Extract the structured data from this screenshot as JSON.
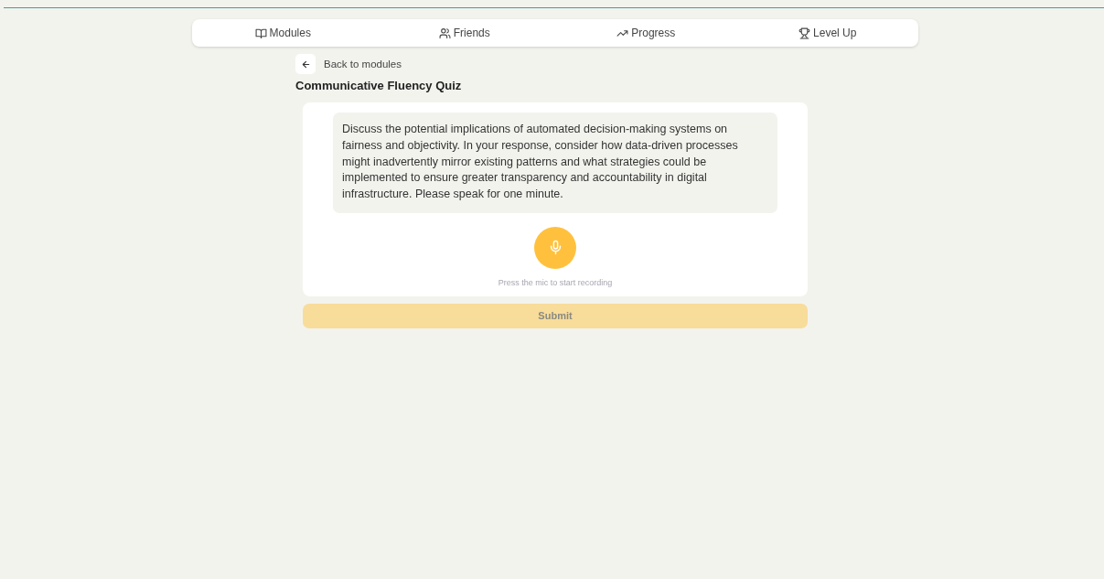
{
  "nav": {
    "items": [
      {
        "label": "Modules"
      },
      {
        "label": "Friends"
      },
      {
        "label": "Progress"
      },
      {
        "label": "Level Up"
      }
    ]
  },
  "back_link": {
    "label": "Back to modules"
  },
  "quiz": {
    "title": "Communicative Fluency Quiz",
    "prompt": "Discuss the potential implications of automated decision-making systems on fairness and objectivity. In your response, consider how data-driven processes might inadvertently mirror existing patterns and what strategies could be implemented to ensure greater transparency and accountability in digital infrastructure. Please speak for one minute.",
    "recording": false,
    "hint": "Press the mic to start recording"
  },
  "submit": {
    "label": "Submit",
    "disabled": true
  }
}
